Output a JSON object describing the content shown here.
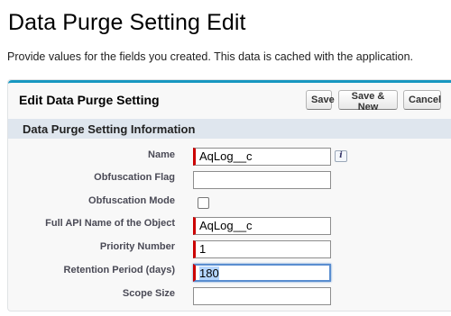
{
  "page": {
    "title": "Data Purge Setting Edit",
    "description": "Provide values for the fields you created. This data is cached with the application."
  },
  "panel": {
    "title": "Edit Data Purge Setting",
    "buttons": {
      "save": "Save",
      "save_new": "Save & New",
      "cancel": "Cancel"
    },
    "section_title": "Data Purge Setting Information"
  },
  "fields": {
    "name": {
      "label": "Name",
      "value": "AqLog__c"
    },
    "obfuscation_flag": {
      "label": "Obfuscation Flag",
      "value": ""
    },
    "obfuscation_mode": {
      "label": "Obfuscation Mode",
      "checked": false
    },
    "full_api_name": {
      "label": "Full API Name of the Object",
      "value": "AqLog__c"
    },
    "priority_number": {
      "label": "Priority Number",
      "value": "1"
    },
    "retention_period": {
      "label": "Retention Period (days)",
      "value": "180"
    },
    "scope_size": {
      "label": "Scope Size",
      "value": ""
    }
  },
  "icons": {
    "info": "info-icon"
  },
  "colors": {
    "accent": "#1797c0",
    "required": "#cc0000",
    "section_bg": "#dfe6ee"
  }
}
